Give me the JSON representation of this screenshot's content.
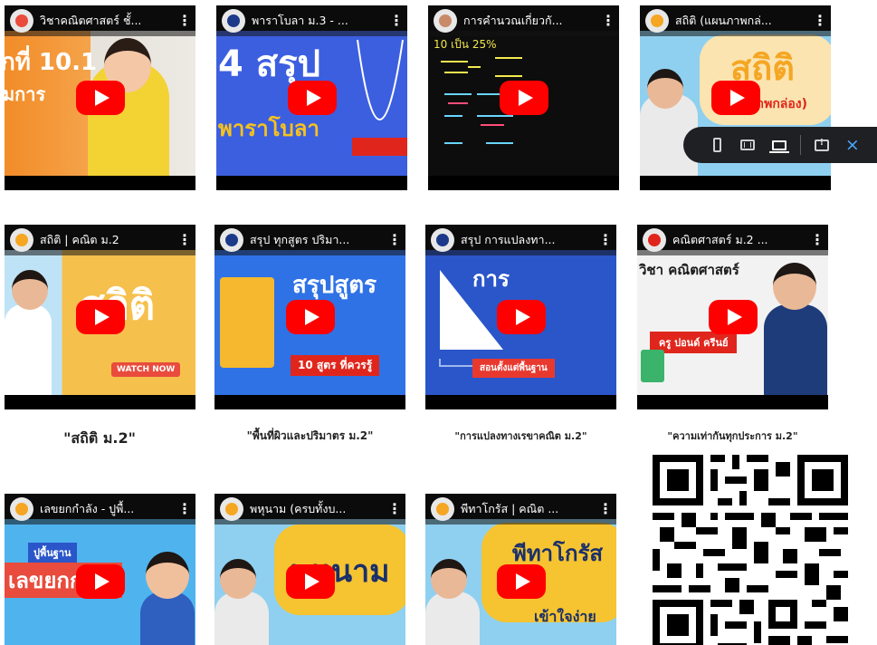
{
  "videos": [
    {
      "title": "วิชาคณิตศาสตร์ ชั้...",
      "thumb_text": "กที่ 10.1",
      "thumb_sub": "มการ",
      "colors": {
        "bg": "#f28c28",
        "accent": "#ffffff"
      }
    },
    {
      "title": "พาราโบลา ม.3 - ...",
      "thumb_text": "4 สรุป",
      "thumb_sub": "พาราโบลา",
      "colors": {
        "bg": "#3c5fe0",
        "accent": "#f7c21c"
      }
    },
    {
      "title": "การคำนวณเกี่ยวกั...",
      "thumb_text": "10 เป็น 25%",
      "thumb_sub": "",
      "colors": {
        "bg": "#0d0d0d",
        "accent": "#f3e94e"
      }
    },
    {
      "title": "สถิติ (แผนภาพกล่...",
      "thumb_text": "สถิติ",
      "thumb_sub": "ภาพกล่อง)",
      "colors": {
        "bg": "#8fd0f0",
        "accent": "#f5a623"
      }
    },
    {
      "title": "สถิติ | คณิต ม.2",
      "thumb_text": "สถิติ",
      "thumb_sub": "WATCH NOW",
      "colors": {
        "bg": "#f6c04d",
        "accent": "#e94b3c"
      }
    },
    {
      "title": "สรุป ทุกสูตร ปริมา...",
      "thumb_text": "สรุปสูตร",
      "thumb_sub": "10 สูตร ที่ควรรู้",
      "colors": {
        "bg": "#2f72e6",
        "accent": "#f5b82e"
      }
    },
    {
      "title": "สรุป การแปลงทา...",
      "thumb_text": "การ",
      "thumb_sub": "สอนตั้งแต่พื้นฐาน",
      "colors": {
        "bg": "#2a56c9",
        "accent": "#e8392f"
      }
    },
    {
      "title": "คณิตศาสตร์ ม.2 ...",
      "thumb_text": "วิชา คณิตศาสตร์",
      "thumb_sub": "ครู ปอนด์ ครีนย์",
      "colors": {
        "bg": "#f2f2f2",
        "accent": "#e0261c"
      }
    },
    {
      "title": "เลขยกกำลัง - ปูพื้...",
      "thumb_text": "เลขยกกำลัง",
      "thumb_sub": "ปูพื้นฐาน",
      "colors": {
        "bg": "#4fb4ee",
        "accent": "#e94b3c"
      }
    },
    {
      "title": "พหุนาม (ครบทั้งบ...",
      "thumb_text": "พหุนาม",
      "thumb_sub": "",
      "colors": {
        "bg": "#8fd0f0",
        "accent": "#f5c430"
      }
    },
    {
      "title": "พีทาโกรัส | คณิต ...",
      "thumb_text": "พีทาโกรัส",
      "thumb_sub": "เข้าใจง่าย",
      "colors": {
        "bg": "#8fd0f0",
        "accent": "#f5c430"
      }
    }
  ],
  "captions": [
    "\"สถิติ ม.2\"",
    "\"พื้นที่ผิวและปริมาตร ม.2\"",
    "\"การแปลงทางเรขาคณิต ม.2\"",
    "\"ความเท่ากันทุกประการ ม.2\""
  ],
  "toolbar": {
    "buttons": [
      "phone-view",
      "tablet-view",
      "laptop-view",
      "comment",
      "close"
    ],
    "close_label": "×"
  },
  "colors": {
    "youtube_red": "#ff0000",
    "toolbar_bg": "#1f2023",
    "close_blue": "#4aa8ff"
  }
}
